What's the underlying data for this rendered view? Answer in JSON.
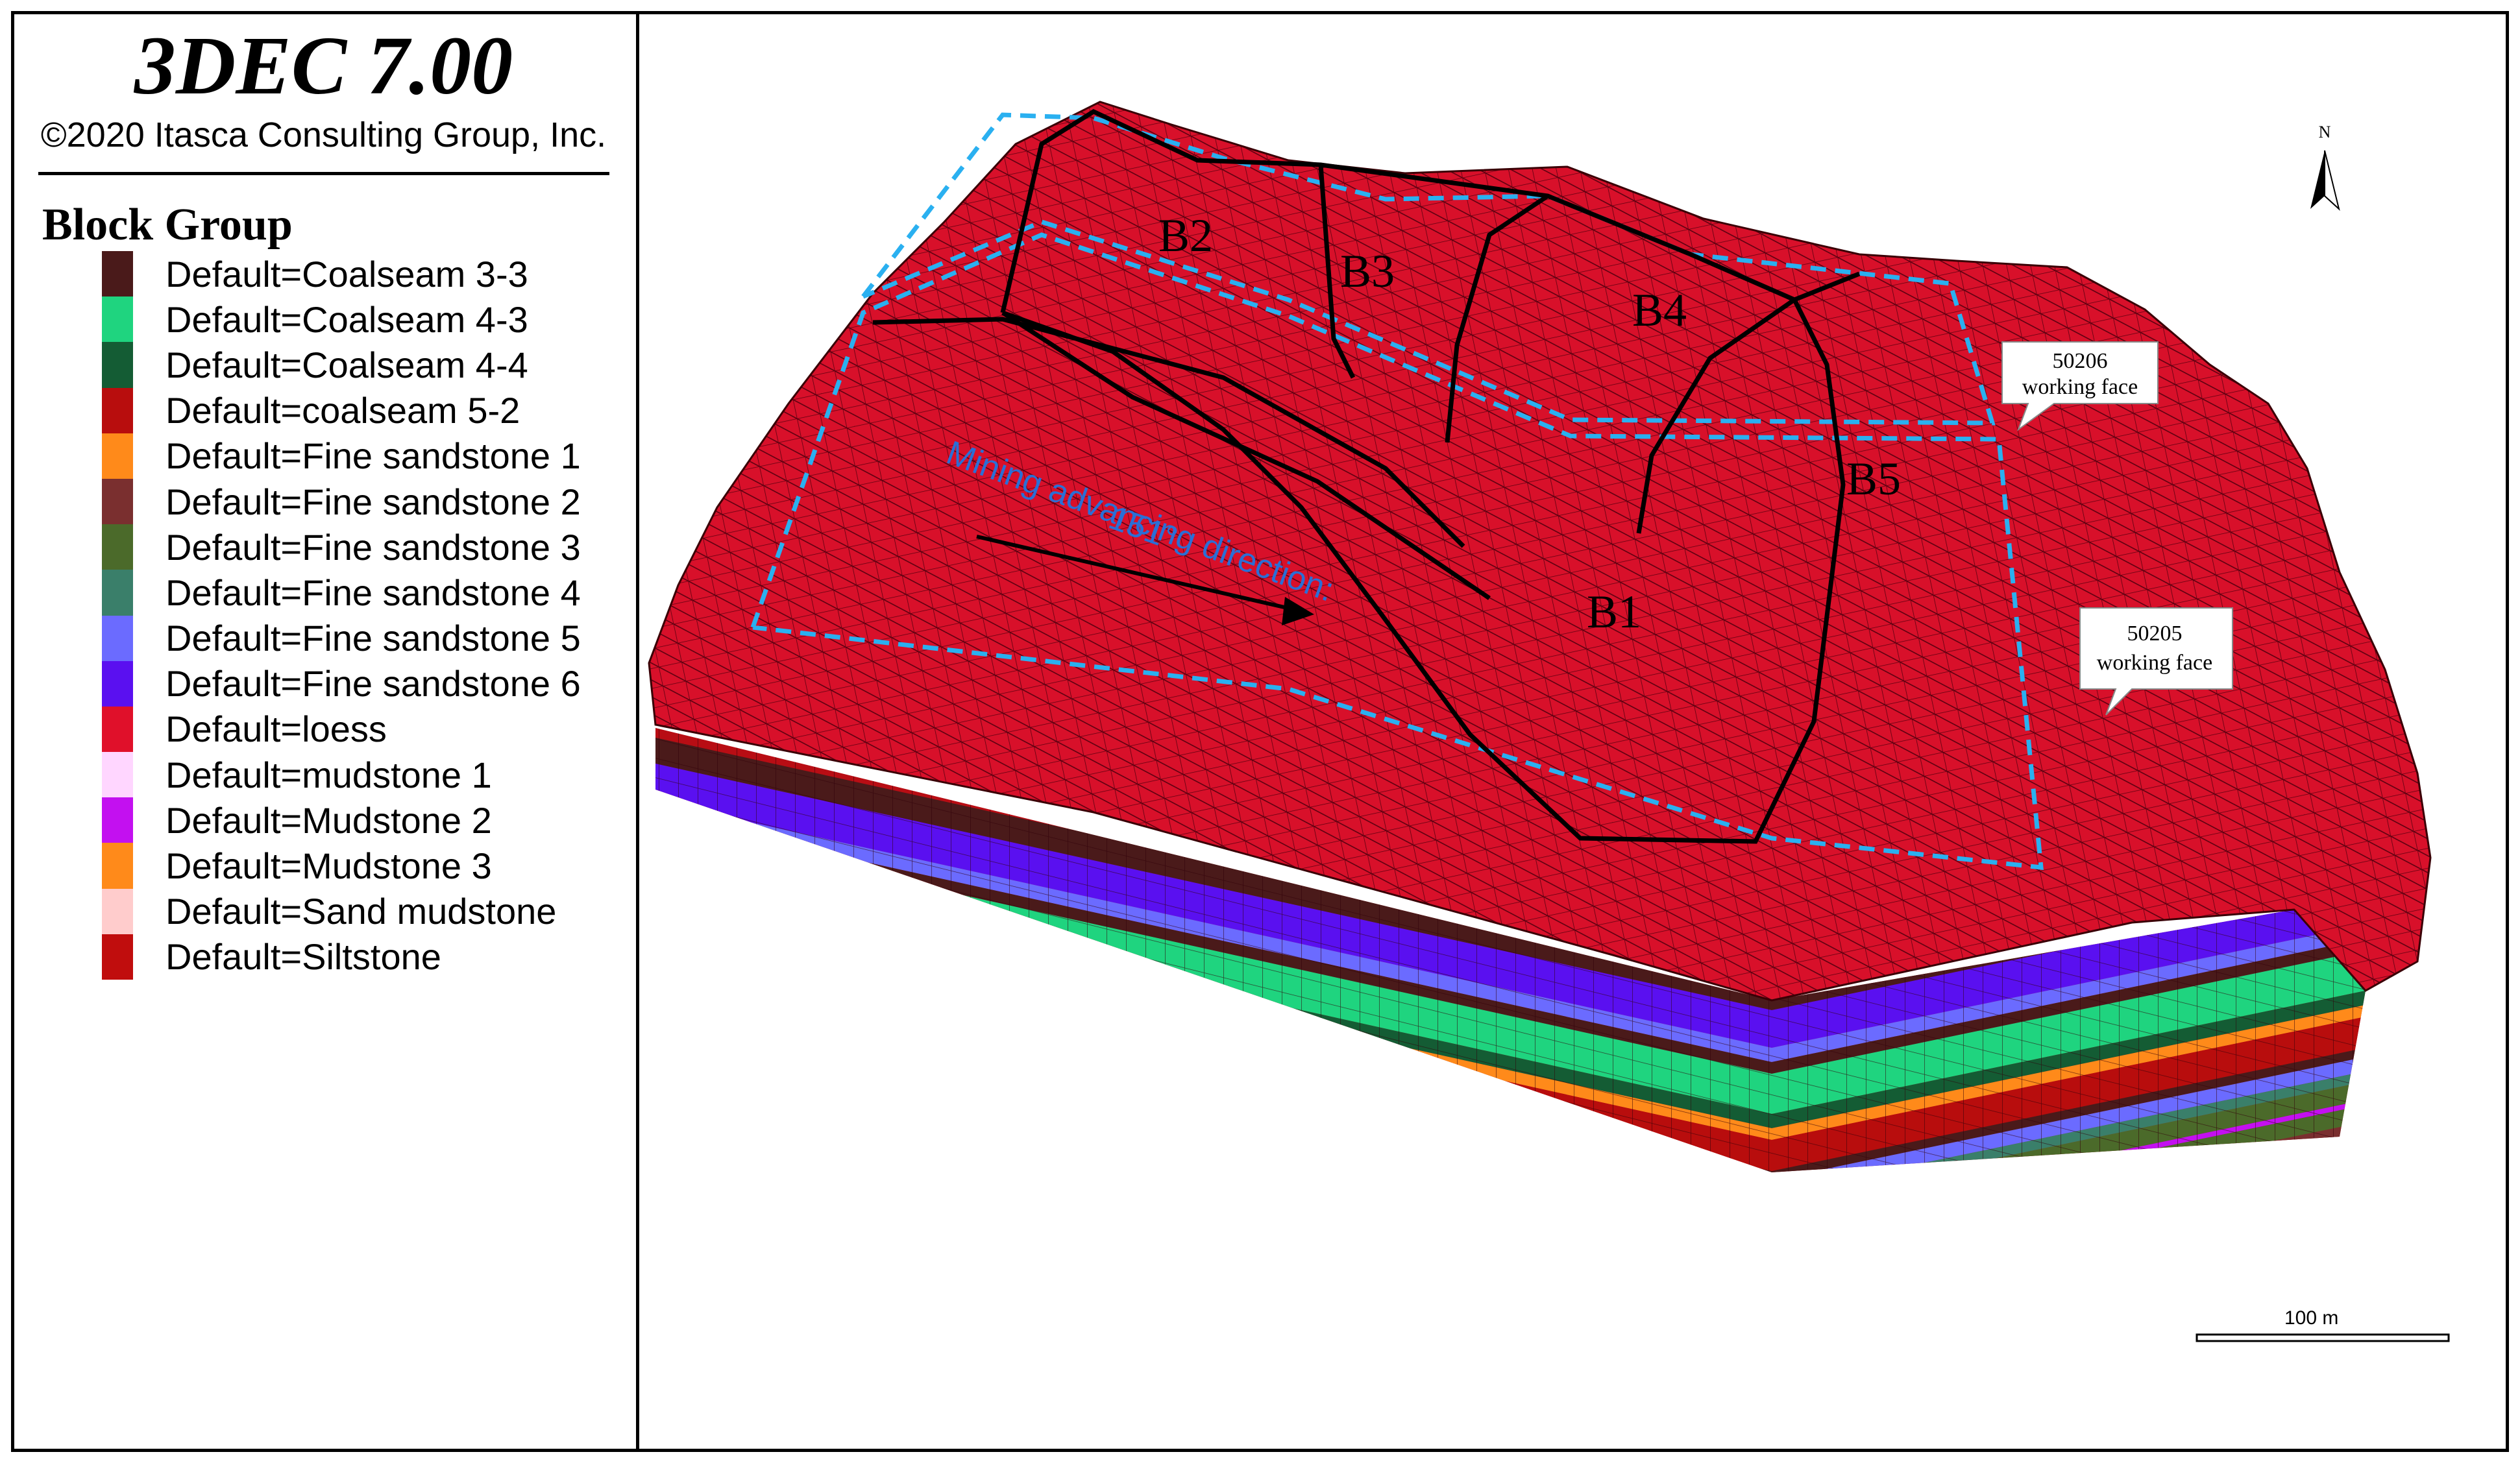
{
  "app": {
    "title": "3DEC 7.00",
    "copyright": "©2020 Itasca Consulting Group, Inc."
  },
  "legend": {
    "title": "Block Group",
    "items": [
      {
        "label": "Default=Coalseam 3-3",
        "color": "#4a1a1a"
      },
      {
        "label": "Default=Coalseam 4-3",
        "color": "#1fd47f"
      },
      {
        "label": "Default=Coalseam 4-4",
        "color": "#145c34"
      },
      {
        "label": "Default=coalseam 5-2",
        "color": "#b80d0d"
      },
      {
        "label": "Default=Fine sandstone 1",
        "color": "#ff8a1a"
      },
      {
        "label": "Default=Fine sandstone 2",
        "color": "#7a2f2f"
      },
      {
        "label": "Default=Fine sandstone 3",
        "color": "#4b6a2a"
      },
      {
        "label": "Default=Fine sandstone 4",
        "color": "#3a7f6a"
      },
      {
        "label": "Default=Fine sandstone 5",
        "color": "#6b6bff"
      },
      {
        "label": "Default=Fine sandstone 6",
        "color": "#5a10f0"
      },
      {
        "label": "Default=loess",
        "color": "#e0102a"
      },
      {
        "label": "Default=mudstone 1",
        "color": "#ffd6ff"
      },
      {
        "label": "Default=Mudstone 2",
        "color": "#c310f0"
      },
      {
        "label": "Default=Mudstone 3",
        "color": "#ff8a1a"
      },
      {
        "label": "Default=Sand mudstone",
        "color": "#ffcccc"
      },
      {
        "label": "Default=Siltstone",
        "color": "#c00d0d"
      }
    ]
  },
  "model": {
    "block_labels": [
      "B1",
      "B2",
      "B3",
      "B4",
      "B5"
    ],
    "working_faces": [
      {
        "id": "50206",
        "text": "working face"
      },
      {
        "id": "50205",
        "text": "working face"
      }
    ],
    "mining_direction": {
      "line1": "Mining advancing direction:",
      "line2": "151°"
    },
    "north_label": "N",
    "scale_bar": "100 m"
  },
  "colors": {
    "terrain": "#d8102a",
    "mesh": "#4a0008",
    "boundary_dashed": "#2ab0f0",
    "boundary_solid": "#000000"
  }
}
